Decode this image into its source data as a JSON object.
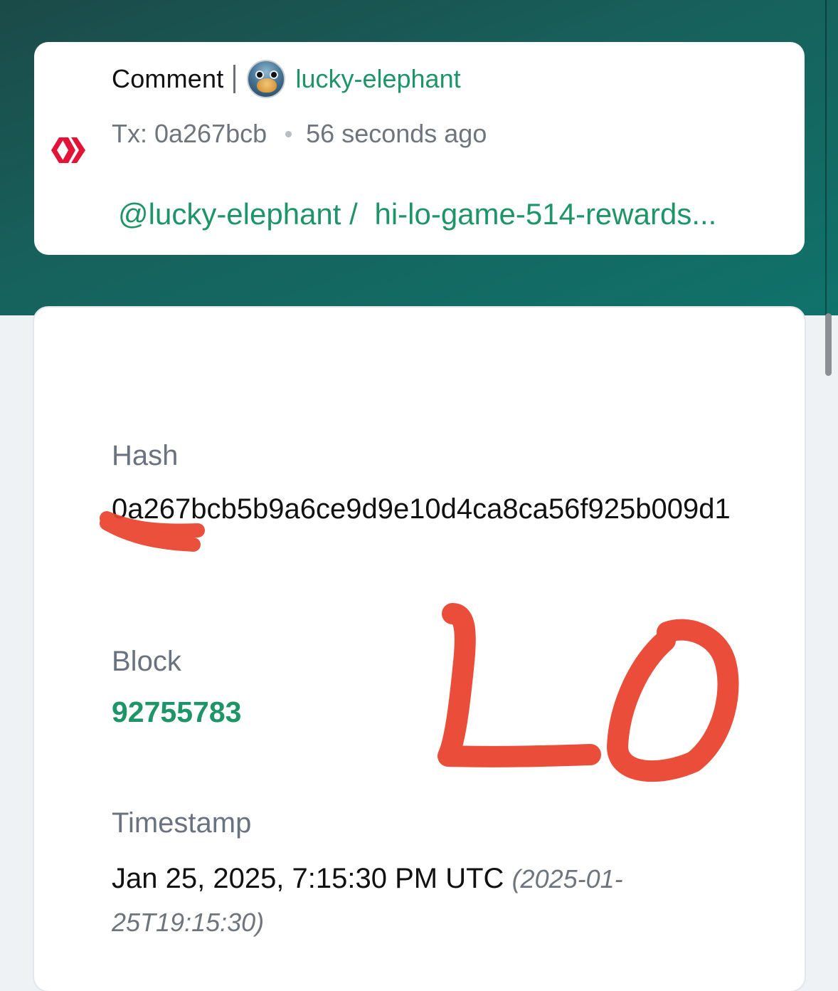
{
  "theme": {
    "accent": "#1e9568",
    "header_gradient": [
      "#1b4a48",
      "#0f736b"
    ],
    "annotation_color": "#e8412b",
    "icon_color": "#e31337"
  },
  "operation": {
    "type": "Comment",
    "user": "lucky-elephant",
    "avatar_icon": "bird-avatar",
    "tx_short": "Tx: 0a267bcb",
    "age": "56 seconds ago",
    "author_link": "@lucky-elephant /",
    "permlink": "hi-lo-game-514-rewards..."
  },
  "details": {
    "hash_label": "Hash",
    "hash_value": "0a267bcb5b9a6ce9d9e10d4ca8ca56f925b009d1",
    "block_label": "Block",
    "block_value": "92755783",
    "timestamp_label": "Timestamp",
    "timestamp_value": "Jan 25, 2025, 7:15:30 PM UTC",
    "timestamp_iso": "(2025-01-25T19:15:30)"
  },
  "annotation": {
    "handwritten_text": "LO"
  }
}
